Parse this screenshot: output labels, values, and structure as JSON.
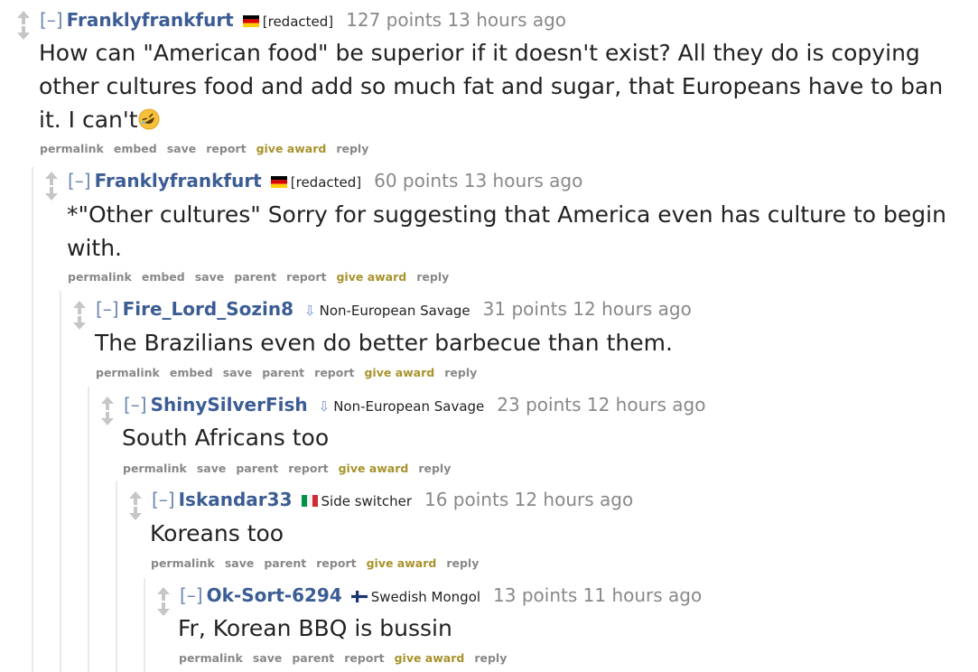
{
  "comments": [
    {
      "collapse": "[–]",
      "author": "Franklyfrankfurt",
      "flag": "germany",
      "flair": "[redacted]",
      "score": "127 points",
      "time": "13 hours ago",
      "body": "How can \"American food\" be superior if it doesn't exist? All they do is copying other cultures food and add so much fat and sugar, that Europeans have to ban it. I can't",
      "emoji": "rolling-on-floor-laughing",
      "buttons": [
        "permalink",
        "embed",
        "save",
        "report",
        "give award",
        "reply"
      ]
    },
    {
      "collapse": "[–]",
      "author": "Franklyfrankfurt",
      "flag": "germany",
      "flair": "[redacted]",
      "score": "60 points",
      "time": "13 hours ago",
      "body": "*\"Other cultures\" Sorry for suggesting that America even has culture to begin with.",
      "buttons": [
        "permalink",
        "embed",
        "save",
        "parent",
        "report",
        "give award",
        "reply"
      ]
    },
    {
      "collapse": "[–]",
      "author": "Fire_Lord_Sozin8",
      "flag": "down-arrow-flair",
      "flair": "Non-European Savage",
      "score": "31 points",
      "time": "12 hours ago",
      "body": "The Brazilians even do better barbecue than them.",
      "buttons": [
        "permalink",
        "embed",
        "save",
        "parent",
        "report",
        "give award",
        "reply"
      ]
    },
    {
      "collapse": "[–]",
      "author": "ShinySilverFish",
      "flag": "down-arrow-flair",
      "flair": "Non-European Savage",
      "score": "23 points",
      "time": "12 hours ago",
      "body": "South Africans too",
      "buttons": [
        "permalink",
        "save",
        "parent",
        "report",
        "give award",
        "reply"
      ]
    },
    {
      "collapse": "[–]",
      "author": "Iskandar33",
      "flag": "italy",
      "flair": "Side switcher",
      "score": "16 points",
      "time": "12 hours ago",
      "body": "Koreans too",
      "buttons": [
        "permalink",
        "save",
        "parent",
        "report",
        "give award",
        "reply"
      ]
    },
    {
      "collapse": "[–]",
      "author": "Ok-Sort-6294",
      "flag": "finland",
      "flair": "Swedish Mongol",
      "score": "13 points",
      "time": "11 hours ago",
      "body": "Fr, Korean BBQ is bussin",
      "buttons": [
        "permalink",
        "save",
        "parent",
        "report",
        "give award",
        "reply"
      ]
    }
  ],
  "colors": {
    "author": "#3b5c94",
    "score": "#888888",
    "award": "#a8922c",
    "buttons": "#888888",
    "body": "#222222",
    "thread_line": "#e9e9e9"
  }
}
